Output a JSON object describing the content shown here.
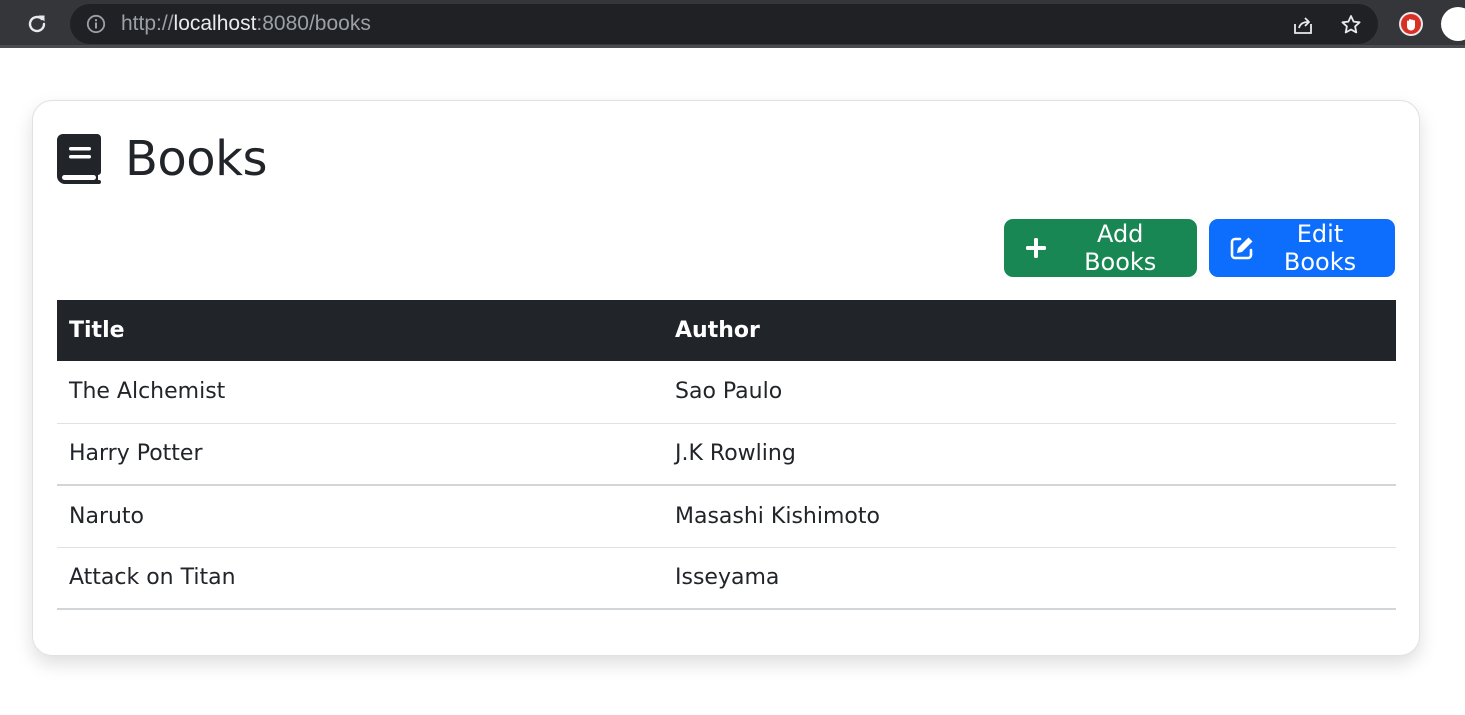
{
  "browser": {
    "url_scheme": "http://",
    "url_host": "localhost",
    "url_rest": ":8080/books",
    "icons": [
      "reload-icon",
      "info-icon",
      "share-icon",
      "star-icon",
      "extension-icon",
      "profile-icon"
    ]
  },
  "page": {
    "title": "Books",
    "title_icon": "book-icon"
  },
  "actions": {
    "add_label": "Add Books",
    "add_icon": "plus-icon",
    "edit_label": "Edit Books",
    "edit_icon": "edit-icon"
  },
  "table": {
    "headers": [
      "Title",
      "Author"
    ],
    "rows": [
      [
        "The Alchemist",
        "Sao Paulo"
      ],
      [
        "Harry Potter",
        "J.K Rowling"
      ],
      [
        "Naruto",
        "Masashi Kishimoto"
      ],
      [
        "Attack on Titan",
        "Isseyama"
      ]
    ]
  },
  "colors": {
    "add_button": "#198754",
    "edit_button": "#0d6efd",
    "table_header": "#212529"
  }
}
